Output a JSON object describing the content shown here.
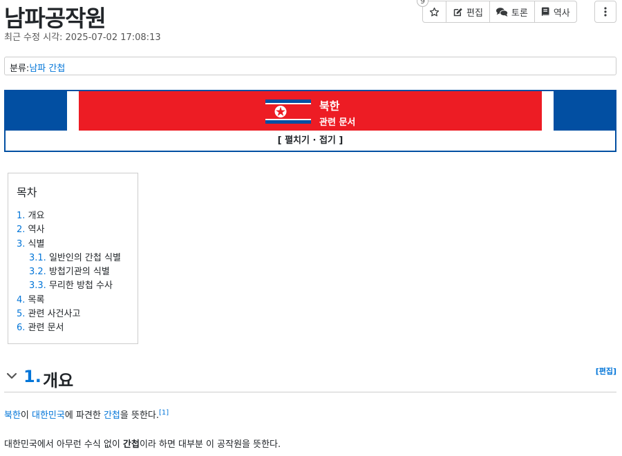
{
  "page": {
    "title": "남파공작원",
    "last_modified_label": "최근 수정 시각: 2025-07-02 17:08:13"
  },
  "toolbar": {
    "star_count": "9",
    "edit_label": "편집",
    "discuss_label": "토론",
    "history_label": "역사"
  },
  "category": {
    "prefix": "분류",
    "colon": ":",
    "link": "남파 간첩"
  },
  "related_box": {
    "title": "북한",
    "subtitle": "관련 문서",
    "toggle": "[ 펼치기 · 접기 ]",
    "colors": {
      "blue": "#024fa2",
      "red": "#ed1c24",
      "white": "#ffffff"
    }
  },
  "toc": {
    "title": "목차",
    "items": [
      {
        "num": "1.",
        "text": "개요"
      },
      {
        "num": "2.",
        "text": "역사"
      },
      {
        "num": "3.",
        "text": "식별"
      },
      {
        "num": "3.1.",
        "text": "일반인의 간첩 식별"
      },
      {
        "num": "3.2.",
        "text": "방첩기관의 식별"
      },
      {
        "num": "3.3.",
        "text": "무리한 방첩 수사"
      },
      {
        "num": "4.",
        "text": "목록"
      },
      {
        "num": "5.",
        "text": "관련 사건사고"
      },
      {
        "num": "6.",
        "text": "관련 문서"
      }
    ]
  },
  "section1": {
    "num": "1.",
    "title": "개요",
    "edit_label": "[편집]"
  },
  "content": {
    "p1": {
      "link1": "북한",
      "t1": "이 ",
      "link2": "대한민국",
      "t2": "에 파견한 ",
      "link3": "간첩",
      "t3": "을 뜻한다.",
      "footnote": "[1]"
    },
    "p2": {
      "t1": "대한민국에서 아무런 수식 없이 ",
      "bold": "간첩",
      "t2": "이라 하면 대부분 이 공작원을 뜻한다."
    }
  }
}
